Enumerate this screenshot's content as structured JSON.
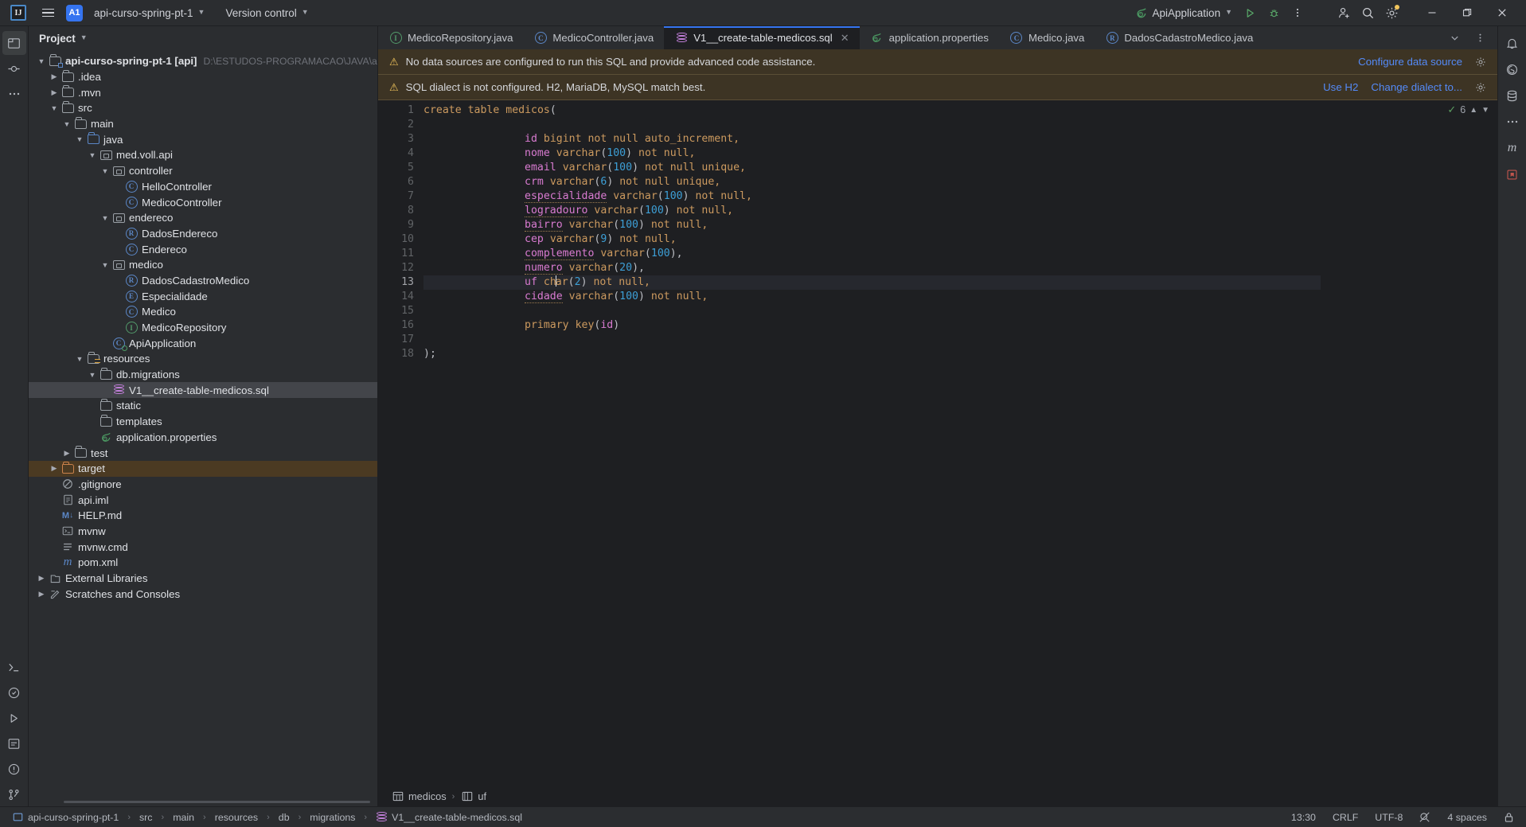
{
  "titlebar": {
    "logo": "IJ",
    "menu_icon": "hamburger-menu-icon",
    "project_badge": "A1",
    "project_name": "api-curso-spring-pt-1",
    "version_control": "Version control",
    "run_config": "ApiApplication",
    "run_icon": "run-icon",
    "debug_icon": "debug-icon",
    "more_icon": "more-vertical-icon",
    "account_icon": "add-user-icon",
    "search_icon": "search-icon",
    "settings_icon": "gear-icon",
    "minimize": "–",
    "maximize": "❐",
    "close": "✕"
  },
  "project_panel": {
    "title": "Project",
    "tree": [
      {
        "depth": 0,
        "twist": "down",
        "icon": "module-folder-icon",
        "label": "api-curso-spring-pt-1 [api]",
        "bold": true,
        "path": "D:\\ESTUDOS-PROGRAMACAO\\JAVA\\api-curso-spr"
      },
      {
        "depth": 1,
        "twist": "right",
        "icon": "folder-icon",
        "label": ".idea"
      },
      {
        "depth": 1,
        "twist": "right",
        "icon": "folder-icon",
        "label": ".mvn"
      },
      {
        "depth": 1,
        "twist": "down",
        "icon": "folder-icon",
        "label": "src"
      },
      {
        "depth": 2,
        "twist": "down",
        "icon": "folder-icon",
        "label": "main"
      },
      {
        "depth": 3,
        "twist": "down",
        "icon": "source-folder-icon",
        "label": "java"
      },
      {
        "depth": 4,
        "twist": "down",
        "icon": "package-icon",
        "label": "med.voll.api"
      },
      {
        "depth": 5,
        "twist": "down",
        "icon": "package-icon",
        "label": "controller"
      },
      {
        "depth": 6,
        "twist": "none",
        "icon": "class-icon",
        "label": "HelloController"
      },
      {
        "depth": 6,
        "twist": "none",
        "icon": "class-icon",
        "label": "MedicoController"
      },
      {
        "depth": 5,
        "twist": "down",
        "icon": "package-icon",
        "label": "endereco"
      },
      {
        "depth": 6,
        "twist": "none",
        "icon": "record-icon",
        "label": "DadosEndereco"
      },
      {
        "depth": 6,
        "twist": "none",
        "icon": "class-icon",
        "label": "Endereco"
      },
      {
        "depth": 5,
        "twist": "down",
        "icon": "package-icon",
        "label": "medico"
      },
      {
        "depth": 6,
        "twist": "none",
        "icon": "record-icon",
        "label": "DadosCadastroMedico"
      },
      {
        "depth": 6,
        "twist": "none",
        "icon": "enum-icon",
        "label": "Especialidade"
      },
      {
        "depth": 6,
        "twist": "none",
        "icon": "class-icon",
        "label": "Medico"
      },
      {
        "depth": 6,
        "twist": "none",
        "icon": "interface-icon",
        "label": "MedicoRepository"
      },
      {
        "depth": 5,
        "twist": "none",
        "icon": "spring-class-icon",
        "label": "ApiApplication"
      },
      {
        "depth": 3,
        "twist": "down",
        "icon": "resources-folder-icon",
        "label": "resources"
      },
      {
        "depth": 4,
        "twist": "down",
        "icon": "folder-icon",
        "label": "db.migrations"
      },
      {
        "depth": 5,
        "twist": "none",
        "icon": "sql-file-icon",
        "label": "V1__create-table-medicos.sql",
        "selected": true
      },
      {
        "depth": 4,
        "twist": "none",
        "icon": "folder-icon",
        "label": "static"
      },
      {
        "depth": 4,
        "twist": "none",
        "icon": "folder-icon",
        "label": "templates"
      },
      {
        "depth": 4,
        "twist": "none",
        "icon": "spring-properties-icon",
        "label": "application.properties"
      },
      {
        "depth": 2,
        "twist": "right",
        "icon": "folder-icon",
        "label": "test"
      },
      {
        "depth": 1,
        "twist": "right",
        "icon": "folder-icon-orange",
        "label": "target",
        "highlight": true
      },
      {
        "depth": 1,
        "twist": "none",
        "icon": "gitignore-icon",
        "label": ".gitignore"
      },
      {
        "depth": 1,
        "twist": "none",
        "icon": "iml-icon",
        "label": "api.iml"
      },
      {
        "depth": 1,
        "twist": "none",
        "icon": "markdown-icon",
        "label": "HELP.md"
      },
      {
        "depth": 1,
        "twist": "none",
        "icon": "shell-icon",
        "label": "mvnw"
      },
      {
        "depth": 1,
        "twist": "none",
        "icon": "cmd-icon",
        "label": "mvnw.cmd"
      },
      {
        "depth": 1,
        "twist": "none",
        "icon": "maven-icon",
        "label": "pom.xml"
      },
      {
        "depth": 0,
        "twist": "right",
        "icon": "libraries-icon",
        "label": "External Libraries"
      },
      {
        "depth": 0,
        "twist": "right",
        "icon": "scratches-icon",
        "label": "Scratches and Consoles"
      }
    ]
  },
  "editor": {
    "tabs": [
      {
        "icon": "interface-icon",
        "label": "MedicoRepository.java",
        "active": false,
        "closable": false
      },
      {
        "icon": "class-icon",
        "label": "MedicoController.java",
        "active": false,
        "closable": false
      },
      {
        "icon": "sql-file-icon",
        "label": "V1__create-table-medicos.sql",
        "active": true,
        "closable": true
      },
      {
        "icon": "spring-properties-icon",
        "label": "application.properties",
        "active": false,
        "closable": false
      },
      {
        "icon": "class-icon",
        "label": "Medico.java",
        "active": false,
        "closable": false
      },
      {
        "icon": "record-icon",
        "label": "DadosCadastroMedico.java",
        "active": false,
        "closable": false
      }
    ],
    "tab_list_icon": "chevron-down-icon",
    "tab_options_icon": "more-vertical-icon",
    "notifications": [
      {
        "icon": "warning-icon",
        "text": "No data sources are configured to run this SQL and provide advanced code assistance.",
        "actions": [
          "Configure data source"
        ],
        "settings_icon": "gear-icon"
      },
      {
        "icon": "warning-icon",
        "text": "SQL dialect is not configured. H2, MariaDB, MySQL match best.",
        "actions": [
          "Use H2",
          "Change dialect to..."
        ],
        "settings_icon": "gear-icon"
      }
    ],
    "inspection_widget": {
      "check_icon": "check-icon",
      "count": "6",
      "up_icon": "chevron-up-icon",
      "down_icon": "chevron-down-icon"
    },
    "code": {
      "language": "sql",
      "lines": [
        {
          "n": 1,
          "tokens": [
            {
              "t": "create",
              "c": "k"
            },
            {
              "t": " ",
              "c": "pl"
            },
            {
              "t": "table",
              "c": "k"
            },
            {
              "t": " ",
              "c": "pl"
            },
            {
              "t": "medicos",
              "c": "k"
            },
            {
              "t": "(",
              "c": "pl"
            }
          ]
        },
        {
          "n": 2,
          "tokens": []
        },
        {
          "n": 3,
          "indent": 16,
          "tokens": [
            {
              "t": "id",
              "c": "col"
            },
            {
              "t": " ",
              "c": "pl"
            },
            {
              "t": "bigint",
              "c": "k"
            },
            {
              "t": " not null auto_increment,",
              "c": "k"
            }
          ]
        },
        {
          "n": 4,
          "indent": 16,
          "tokens": [
            {
              "t": "nome",
              "c": "col"
            },
            {
              "t": " ",
              "c": "pl"
            },
            {
              "t": "varchar",
              "c": "k"
            },
            {
              "t": "(",
              "c": "pl"
            },
            {
              "t": "100",
              "c": "num"
            },
            {
              "t": ")",
              "c": "pl"
            },
            {
              "t": " not null,",
              "c": "k"
            }
          ]
        },
        {
          "n": 5,
          "indent": 16,
          "tokens": [
            {
              "t": "email",
              "c": "col"
            },
            {
              "t": " ",
              "c": "pl"
            },
            {
              "t": "varchar",
              "c": "k"
            },
            {
              "t": "(",
              "c": "pl"
            },
            {
              "t": "100",
              "c": "num"
            },
            {
              "t": ")",
              "c": "pl"
            },
            {
              "t": " not null unique,",
              "c": "k"
            }
          ]
        },
        {
          "n": 6,
          "indent": 16,
          "tokens": [
            {
              "t": "crm",
              "c": "col"
            },
            {
              "t": " ",
              "c": "pl"
            },
            {
              "t": "varchar",
              "c": "k"
            },
            {
              "t": "(",
              "c": "pl"
            },
            {
              "t": "6",
              "c": "num"
            },
            {
              "t": ")",
              "c": "pl"
            },
            {
              "t": " not null unique,",
              "c": "k"
            }
          ]
        },
        {
          "n": 7,
          "indent": 16,
          "tokens": [
            {
              "t": "especialidade",
              "c": "col und"
            },
            {
              "t": " ",
              "c": "pl"
            },
            {
              "t": "varchar",
              "c": "k"
            },
            {
              "t": "(",
              "c": "pl"
            },
            {
              "t": "100",
              "c": "num"
            },
            {
              "t": ")",
              "c": "pl"
            },
            {
              "t": " not null,",
              "c": "k"
            }
          ]
        },
        {
          "n": 8,
          "indent": 16,
          "tokens": [
            {
              "t": "logradouro",
              "c": "col und"
            },
            {
              "t": " ",
              "c": "pl"
            },
            {
              "t": "varchar",
              "c": "k"
            },
            {
              "t": "(",
              "c": "pl"
            },
            {
              "t": "100",
              "c": "num"
            },
            {
              "t": ")",
              "c": "pl"
            },
            {
              "t": " not null,",
              "c": "k"
            }
          ]
        },
        {
          "n": 9,
          "indent": 16,
          "tokens": [
            {
              "t": "bairro",
              "c": "col und"
            },
            {
              "t": " ",
              "c": "pl"
            },
            {
              "t": "varchar",
              "c": "k"
            },
            {
              "t": "(",
              "c": "pl"
            },
            {
              "t": "100",
              "c": "num"
            },
            {
              "t": ")",
              "c": "pl"
            },
            {
              "t": " not null,",
              "c": "k"
            }
          ]
        },
        {
          "n": 10,
          "indent": 16,
          "tokens": [
            {
              "t": "cep",
              "c": "col"
            },
            {
              "t": " ",
              "c": "pl"
            },
            {
              "t": "varchar",
              "c": "k"
            },
            {
              "t": "(",
              "c": "pl"
            },
            {
              "t": "9",
              "c": "num"
            },
            {
              "t": ")",
              "c": "pl"
            },
            {
              "t": " not null,",
              "c": "k"
            }
          ]
        },
        {
          "n": 11,
          "indent": 16,
          "tokens": [
            {
              "t": "complemento",
              "c": "col und"
            },
            {
              "t": " ",
              "c": "pl"
            },
            {
              "t": "varchar",
              "c": "k"
            },
            {
              "t": "(",
              "c": "pl"
            },
            {
              "t": "100",
              "c": "num"
            },
            {
              "t": "),",
              "c": "pl"
            }
          ]
        },
        {
          "n": 12,
          "indent": 16,
          "tokens": [
            {
              "t": "numero",
              "c": "col und"
            },
            {
              "t": " ",
              "c": "pl"
            },
            {
              "t": "varchar",
              "c": "k"
            },
            {
              "t": "(",
              "c": "pl"
            },
            {
              "t": "20",
              "c": "num"
            },
            {
              "t": "),",
              "c": "pl"
            }
          ]
        },
        {
          "n": 13,
          "indent": 16,
          "current": true,
          "bulb": true,
          "tokens": [
            {
              "t": "uf",
              "c": "col"
            },
            {
              "t": " ",
              "c": "pl"
            },
            {
              "t": "char",
              "c": "k"
            },
            {
              "t": "(",
              "c": "pl"
            },
            {
              "t": "2",
              "c": "num"
            },
            {
              "t": ")",
              "c": "pl"
            },
            {
              "t": " not null,",
              "c": "k"
            }
          ]
        },
        {
          "n": 14,
          "indent": 16,
          "tokens": [
            {
              "t": "cidade",
              "c": "col und"
            },
            {
              "t": " ",
              "c": "pl"
            },
            {
              "t": "varchar",
              "c": "k"
            },
            {
              "t": "(",
              "c": "pl"
            },
            {
              "t": "100",
              "c": "num"
            },
            {
              "t": ")",
              "c": "pl"
            },
            {
              "t": " not null,",
              "c": "k"
            }
          ]
        },
        {
          "n": 15,
          "tokens": []
        },
        {
          "n": 16,
          "indent": 16,
          "tokens": [
            {
              "t": "primary",
              "c": "k"
            },
            {
              "t": " ",
              "c": "pl"
            },
            {
              "t": "key",
              "c": "k"
            },
            {
              "t": "(",
              "c": "pl"
            },
            {
              "t": "id",
              "c": "col"
            },
            {
              "t": ")",
              "c": "pl"
            }
          ]
        },
        {
          "n": 17,
          "tokens": []
        },
        {
          "n": 18,
          "tokens": [
            {
              "t": ");",
              "c": "pl"
            }
          ]
        }
      ]
    },
    "breadcrumb": [
      {
        "icon": "table-icon",
        "label": "medicos"
      },
      {
        "icon": "column-icon",
        "label": "uf"
      }
    ]
  },
  "right_rail": {
    "icons": [
      "notifications-icon",
      "ai-assistant-icon",
      "database-icon",
      "more-tools-icon",
      "maven-icon",
      "bookmarks-icon"
    ]
  },
  "left_rail": {
    "top_icons": [
      "project-icon",
      "commit-icon",
      "more-tool-windows-icon"
    ],
    "bottom_icons": [
      "terminal-icon",
      "services-icon",
      "run-icon",
      "build-icon",
      "problems-icon",
      "version-control-icon"
    ]
  },
  "status_bar": {
    "breadcrumb": [
      {
        "icon": "module-icon",
        "label": "api-curso-spring-pt-1"
      },
      {
        "label": "src"
      },
      {
        "label": "main"
      },
      {
        "label": "resources"
      },
      {
        "label": "db"
      },
      {
        "label": "migrations"
      },
      {
        "icon": "sql-file-icon",
        "label": "V1__create-table-medicos.sql"
      }
    ],
    "caret": "13:30",
    "line_sep": "CRLF",
    "encoding": "UTF-8",
    "indent": "4 spaces",
    "lens_icon": "inspection-lens-icon",
    "lock_icon": "lock-icon"
  },
  "colors": {
    "accent": "#3574f0",
    "warning_bg": "#3d3424",
    "warning_icon": "#f2c55c",
    "link": "#548af7",
    "panel_bg": "#2b2d30",
    "editor_bg": "#1e1f22",
    "keyword": "#cc9a5f",
    "column": "#d97bd1",
    "number": "#3d9fd6"
  }
}
